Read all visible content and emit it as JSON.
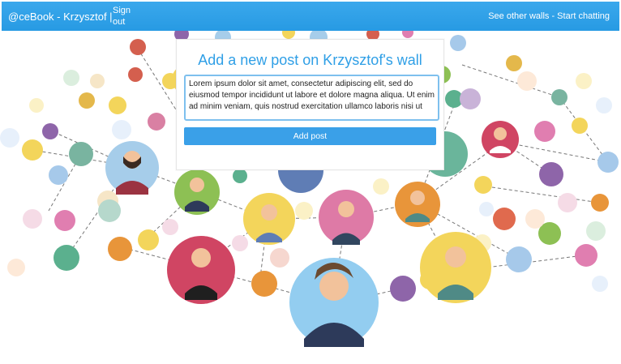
{
  "navbar": {
    "brand": "@ceBook - Krzysztof |",
    "sign_out": "Sign out",
    "right_links": "See other walls - Start chatting"
  },
  "post_panel": {
    "title": "Add a new post on Krzysztof's wall",
    "textarea_value": "Lorem ipsum dolor sit amet, consectetur adipiscing elit, sed do eiusmod tempor incididunt ut labore et dolore magna aliqua. Ut enim ad minim veniam, quis nostrud exercitation ullamco laboris nisi ut",
    "submit_label": "Add post"
  },
  "colors": {
    "accent": "#2f9fe6",
    "button": "#3aa0e8"
  }
}
